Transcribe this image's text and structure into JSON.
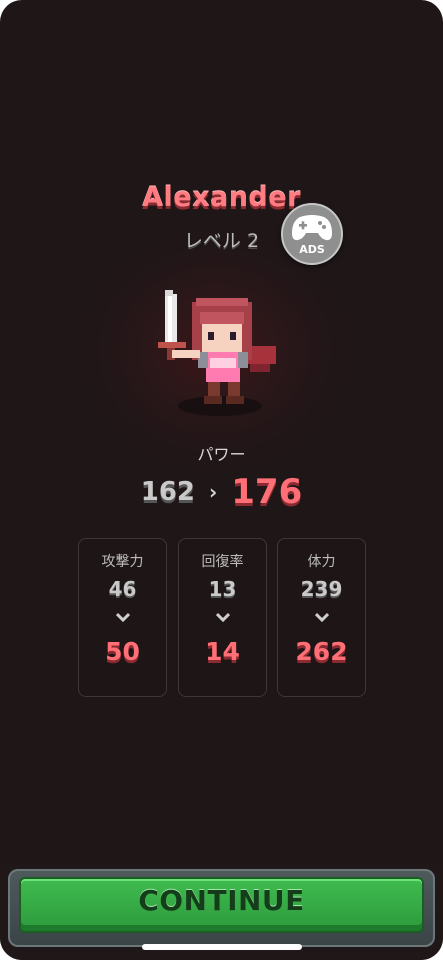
{
  "hero": {
    "name": "Alexander",
    "level": "レベル 2"
  },
  "ads": {
    "label": "ADS",
    "icon": "gamepad-icon"
  },
  "power": {
    "label": "パワー",
    "old": "162",
    "arrow": "›",
    "new": "176"
  },
  "stats": [
    {
      "label": "攻撃力",
      "old": "46",
      "new": "50"
    },
    {
      "label": "回復率",
      "old": "13",
      "new": "14"
    },
    {
      "label": "体力",
      "old": "239",
      "new": "262"
    }
  ],
  "continue_label": "CONTINUE",
  "colors": {
    "accent": "#ff6f75",
    "button_green": "#2d9a3c",
    "background": "#201618"
  }
}
